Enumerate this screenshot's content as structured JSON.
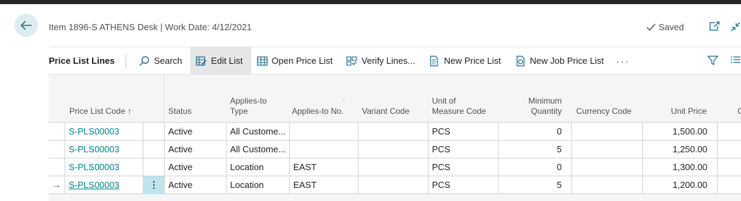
{
  "header": {
    "title": "Item 1896-S ATHENS Desk | Work Date: 4/12/2021",
    "saved": "Saved"
  },
  "toolbar": {
    "title": "Price List Lines",
    "actions": [
      "Search",
      "Edit List",
      "Open Price List",
      "Verify Lines...",
      "New Price List",
      "New Job Price List"
    ],
    "more": "···"
  },
  "columns": {
    "price_list_code": "Price List Code ↑",
    "status": "Status",
    "applies_to_type_1": "Applies-to",
    "applies_to_type_2": "Type",
    "applies_to_no": "Applies-to No.",
    "variant_code": "Variant Code",
    "uom_1": "Unit of",
    "uom_2": "Measure Code",
    "min_qty_1": "Minimum",
    "min_qty_2": "Quantity",
    "currency_code": "Currency Code",
    "unit_price": "Unit Price"
  },
  "rows": [
    [
      "S-PLS00003",
      "",
      "Active",
      "All Custome...",
      "",
      "",
      "PCS",
      "0",
      "",
      "1,500.00"
    ],
    [
      "S-PLS00003",
      "",
      "Active",
      "All Custome...",
      "",
      "",
      "PCS",
      "5",
      "",
      "1,250.00"
    ],
    [
      "S-PLS00003",
      "",
      "Active",
      "Location",
      "EAST",
      "",
      "PCS",
      "0",
      "",
      "1,300.00"
    ],
    [
      "S-PLS00003",
      "⋮",
      "Active",
      "Location",
      "EAST",
      "",
      "PCS",
      "5",
      "",
      "1,200.00"
    ]
  ],
  "current_row_marker": "→",
  "colors": {
    "accent": "#00838f",
    "back_button": "#dcedf1",
    "selected_cell": "#bfe4eb"
  }
}
